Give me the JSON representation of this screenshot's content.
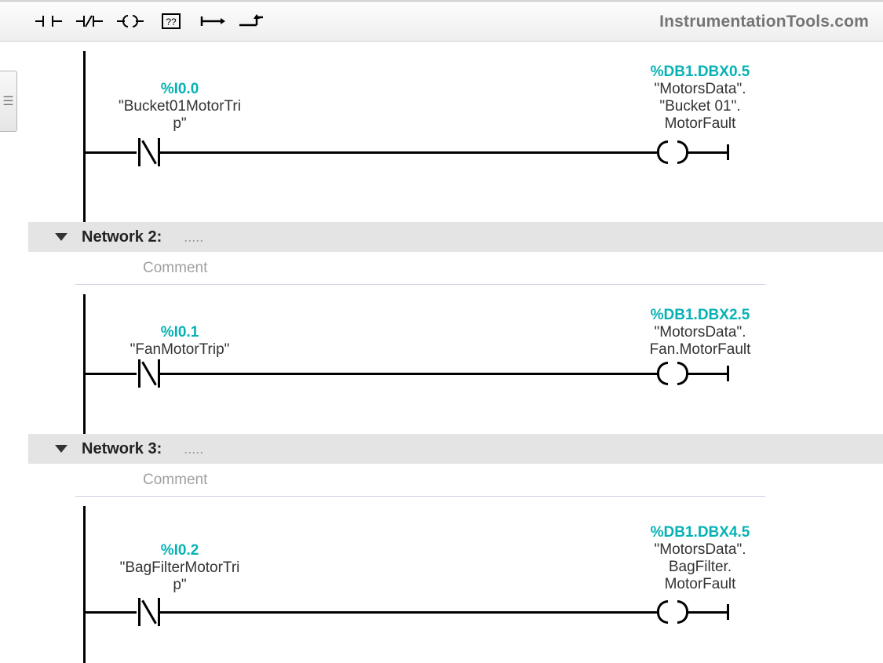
{
  "watermark": "InstrumentationTools.com",
  "commentPlaceholder": "Comment",
  "networks": [
    {
      "title": "Network 2:",
      "dots": "....."
    },
    {
      "title": "Network 3:",
      "dots": "....."
    }
  ],
  "rung1": {
    "contactAddr": "%I0.0",
    "contactSym1": "\"Bucket01MotorTri",
    "contactSym2": "p\"",
    "coilAddr": "%DB1.DBX0.5",
    "coilSym1": "\"MotorsData\".",
    "coilSym2": "\"Bucket 01\".",
    "coilSym3": "MotorFault"
  },
  "rung2": {
    "contactAddr": "%I0.1",
    "contactSym1": "\"FanMotorTrip\"",
    "coilAddr": "%DB1.DBX2.5",
    "coilSym1": "\"MotorsData\".",
    "coilSym2": "Fan.MotorFault"
  },
  "rung3": {
    "contactAddr": "%I0.2",
    "contactSym1": "\"BagFilterMotorTri",
    "contactSym2": "p\"",
    "coilAddr": "%DB1.DBX4.5",
    "coilSym1": "\"MotorsData\".",
    "coilSym2": "BagFilter.",
    "coilSym3": "MotorFault"
  }
}
